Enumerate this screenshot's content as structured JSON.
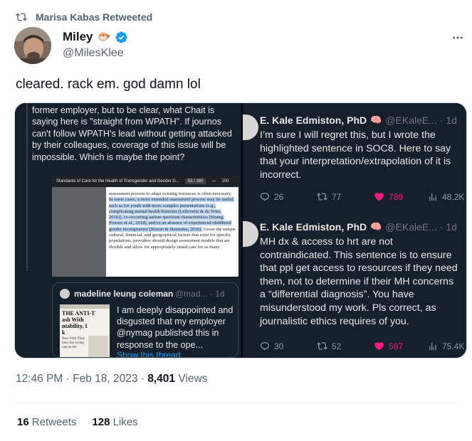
{
  "retweet": {
    "label": "Marisa Kabas Retweeted"
  },
  "author": {
    "name": "Miley",
    "emoji": "🐡",
    "handle": "@MilesKlee"
  },
  "tweet": {
    "text": "cleared. rack em. god damn lol"
  },
  "media": {
    "left": {
      "text": "former employer, but to be clear, what Chait is saying here is \"straight from WPATH\". If journos can't follow WPATH's lead without getting attacked by their colleagues, coverage of this issue will be impossible. Which is maybe the point?",
      "pdf": {
        "title": "Standards of Care for the Health of Transgender and Gender D...",
        "page": "53 / 260",
        "zoom": "100",
        "text_before": "assessment process to adapt existing resources is often necessary.",
        "text_highlight": "In some cases, a more extended assessment process may be useful, such as for youth with more complex presentations (e.g., complicating mental health histories (Leibowitz & de Vries, 2016)), co-occurring autism spectrum characteristics (Strang, Powers et al., 2018), and/or an absence of experienced childhood gender incongruence (Ristori & Steensma, 2016).",
        "text_after": "Given the unique cultural, financial, and geographical factors that exist for specific populations, providers should design assessment models that are flexible and allow for appropriately timed care for as many"
      },
      "quote": {
        "name": "madeline leung coleman",
        "handle": "@mad... · 1d",
        "text": "I am deeply disappointed and disgusted that my employer @nymag published this in response to the ope...",
        "link": "Show this thread",
        "thumb_text": [
          "THE ANTI-T",
          "ash With",
          "ntability, I",
          "k",
          "New York Time",
          "have the wrong",
          "cap on the"
        ]
      }
    },
    "right": {
      "tweets": [
        {
          "name": "E. Kale Edmiston, PhD",
          "emoji": "🧠",
          "handle": "@EKaleE... · 1d",
          "lines": [
            "I’m sure I will regret this, but I wrote the",
            "highlighted sentence in SOC8. Here to say",
            "that your interpretation/extrapolation of it is",
            "incorrect."
          ],
          "replies": "26",
          "retweets": "77",
          "likes": "789",
          "views": "48.2K"
        },
        {
          "name": "E. Kale Edmiston, PhD",
          "emoji": "🧠",
          "handle": "@EKaleE... · 1d",
          "lines": [
            "MH dx & access to hrt are not",
            "contraindicated. This sentence is to ensure",
            "that ppl get access to resources if they need",
            "them, not to determine if their MH concerns",
            "a “differential diagnosis”. You have",
            "misunderstood my work. Pls correct, as",
            "journalistic ethics requires of you."
          ],
          "replies": "30",
          "retweets": "52",
          "likes": "587",
          "views": "75.4K"
        }
      ]
    }
  },
  "meta": {
    "time": "12:46 PM · Feb 18, 2023 · ",
    "views_count": "8,401",
    "views_label": " Views"
  },
  "stats": {
    "retweets_count": "16",
    "retweets_label": " Retweets",
    "likes_count": "128",
    "likes_label": " Likes"
  },
  "colors": {
    "accent": "#1d9bf0",
    "like": "#f91880",
    "dark_bg": "#15202b"
  },
  "icons": {
    "retweet": "retweet-icon",
    "verified": "verified-badge-icon",
    "more": "more-icon",
    "reply": "reply-icon",
    "like": "heart-icon",
    "views": "views-icon"
  }
}
